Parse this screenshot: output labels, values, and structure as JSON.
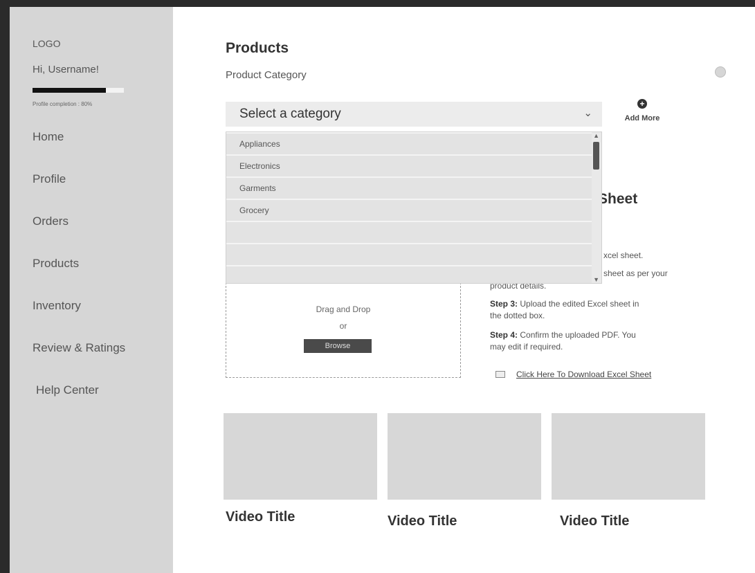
{
  "sidebar": {
    "logo": "LOGO",
    "greeting": "Hi, Username!",
    "profile_completion_text": "Profile completion : 80%",
    "profile_completion": 0.8,
    "nav": [
      {
        "label": "Home"
      },
      {
        "label": "Profile"
      },
      {
        "label": "Orders"
      },
      {
        "label": "Products"
      },
      {
        "label": "Inventory"
      },
      {
        "label": "Review & Ratings"
      },
      {
        "label": "Help Center"
      }
    ]
  },
  "main": {
    "title": "Products",
    "subtitle": "Product Category",
    "select": {
      "value": "Select a category"
    },
    "add_more": "Add More",
    "dropdown_options": [
      "Appliances",
      "Electronics",
      "Garments",
      "Grocery",
      "",
      "",
      ""
    ],
    "upload": {
      "drag": "Drag and Drop",
      "or": "or",
      "browse": "Browse"
    },
    "sheet_title": "Sheet",
    "steps": {
      "s1_tail": "xcel sheet.",
      "s2_tail": "sheet as per your",
      "s2_cont": "product details.",
      "s3_label": "Step 3:",
      "s3_text": " Upload the edited Excel sheet in",
      "s3_cont": "the dotted box.",
      "s4_label": "Step 4:",
      "s4_text": " Confirm the uploaded PDF. You",
      "s4_cont": "may edit if required."
    },
    "download_link": "Click Here To Download Excel Sheet",
    "videos": [
      {
        "title": "Video Title"
      },
      {
        "title": "Video Title"
      },
      {
        "title": "Video Title"
      }
    ]
  },
  "colors": {
    "sidebar_bg": "#d6d6d6",
    "accent_dark": "#4a4a4a",
    "placeholder": "#d7d7d7"
  }
}
